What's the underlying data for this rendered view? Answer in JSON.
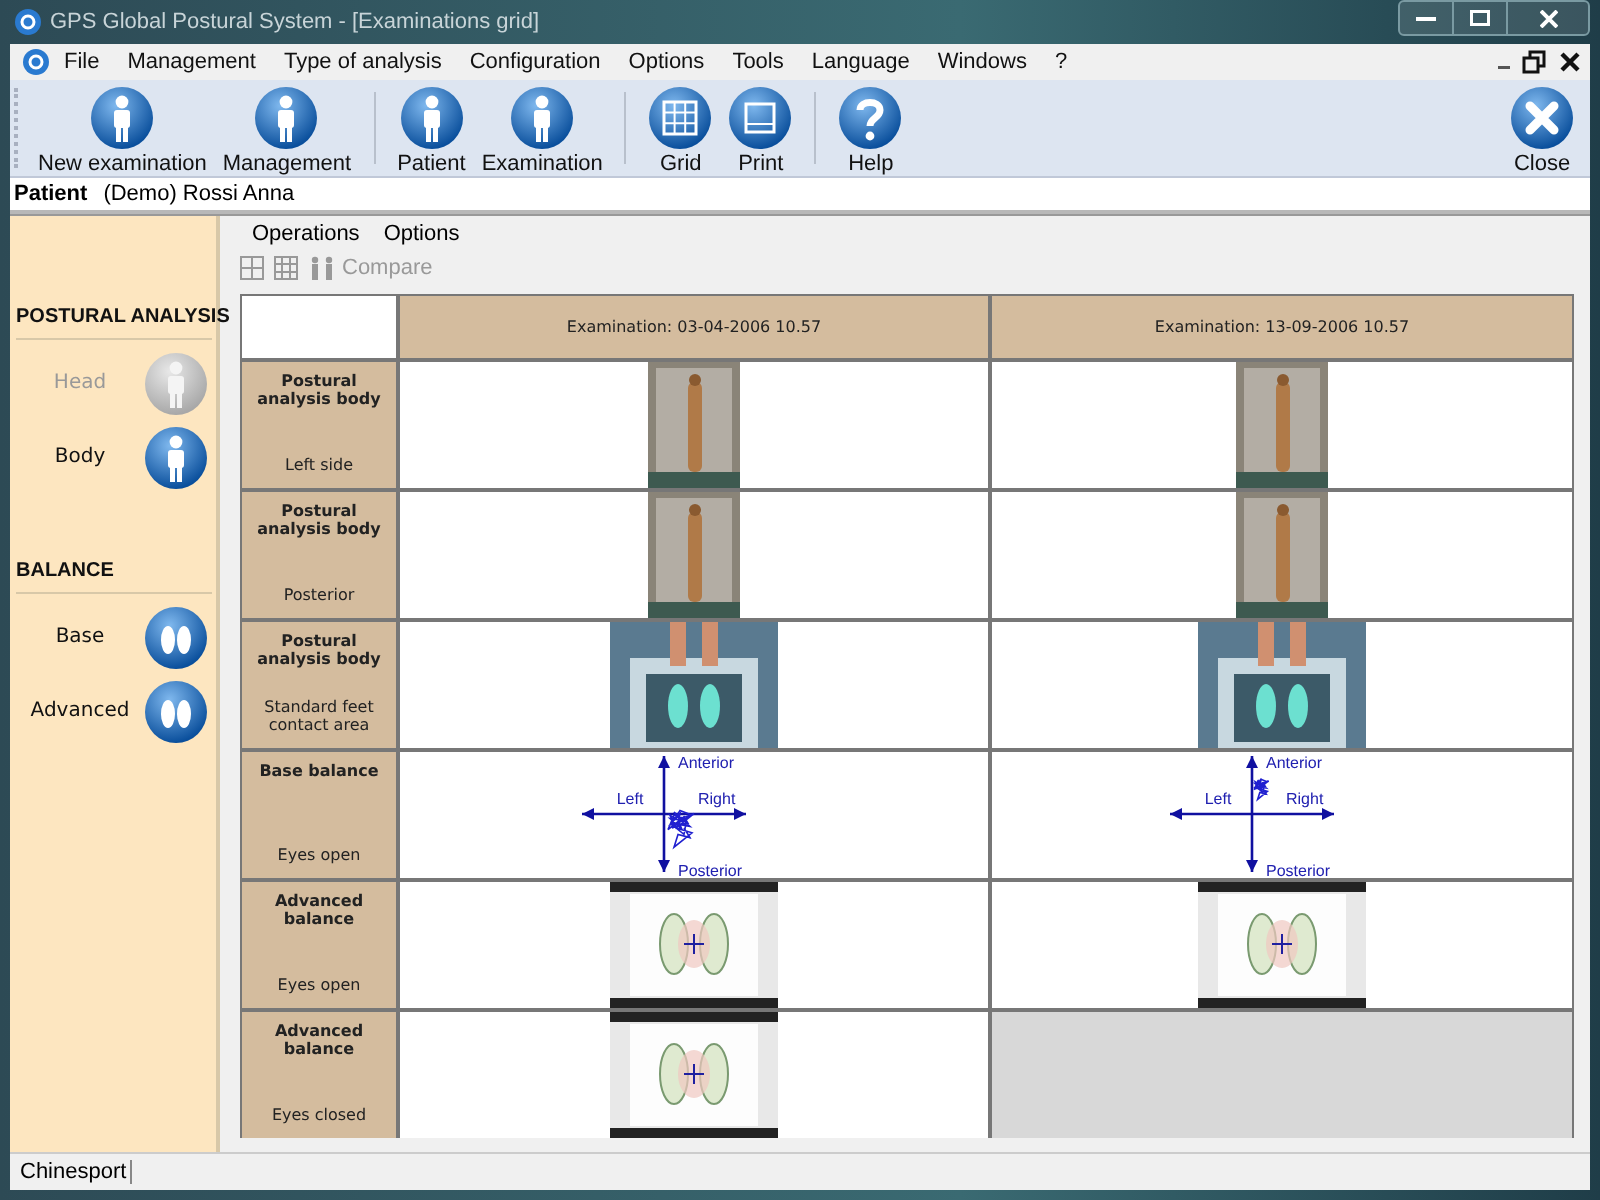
{
  "window": {
    "title": "GPS Global Postural System - [Examinations grid]"
  },
  "menu_bar": {
    "items": [
      "File",
      "Management",
      "Type of analysis",
      "Configuration",
      "Options",
      "Tools",
      "Language",
      "Windows",
      "?"
    ]
  },
  "toolbar": {
    "groups": [
      [
        {
          "label": "New examination"
        },
        {
          "label": "Management"
        }
      ],
      [
        {
          "label": "Patient"
        },
        {
          "label": "Examination"
        }
      ],
      [
        {
          "label": "Grid"
        },
        {
          "label": "Print"
        }
      ],
      [
        {
          "label": "Help"
        }
      ]
    ],
    "close": {
      "label": "Close"
    }
  },
  "patient_bar": {
    "label": "Patient",
    "value": "(Demo) Rossi Anna"
  },
  "sidebar": {
    "sections": [
      {
        "title": "POSTURAL ANALYSIS",
        "items": [
          {
            "label": "Head",
            "disabled": true
          },
          {
            "label": "Body",
            "disabled": false
          }
        ]
      },
      {
        "title": "BALANCE",
        "items": [
          {
            "label": "Base",
            "disabled": false
          },
          {
            "label": "Advanced",
            "disabled": false
          }
        ]
      }
    ]
  },
  "grid_menu": {
    "items": [
      "Operations",
      "Options"
    ]
  },
  "grid_toolbar": {
    "compare": "Compare"
  },
  "table": {
    "columns": [
      "Examination: 03-04-2006 10.57",
      "Examination: 13-09-2006 10.57"
    ],
    "rows": [
      {
        "title": "Postural analysis body",
        "subtitle": "Left side",
        "cells": [
          {
            "kind": "side"
          },
          {
            "kind": "side"
          }
        ]
      },
      {
        "title": "Postural analysis body",
        "subtitle": "Posterior",
        "cells": [
          {
            "kind": "back"
          },
          {
            "kind": "back"
          }
        ]
      },
      {
        "title": "Postural analysis body",
        "subtitle": "Standard feet contact area",
        "cells": [
          {
            "kind": "feet"
          },
          {
            "kind": "feet"
          }
        ]
      },
      {
        "title": "Base balance",
        "subtitle": "Eyes open",
        "cells": [
          {
            "kind": "stabilogram",
            "top": "Anterior",
            "left": "Left",
            "right": "Right",
            "bottom": "Posterior"
          },
          {
            "kind": "stabilogram",
            "top": "Anterior",
            "left": "Left",
            "right": "Right",
            "bottom": "Posterior"
          }
        ]
      },
      {
        "title": "Advanced balance",
        "subtitle": "Eyes open",
        "cells": [
          {
            "kind": "footprint"
          },
          {
            "kind": "footprint"
          }
        ]
      },
      {
        "title": "Advanced balance",
        "subtitle": "Eyes closed",
        "cells": [
          {
            "kind": "footprint"
          },
          {
            "kind": "empty"
          }
        ]
      }
    ]
  },
  "status_bar": {
    "text": "Chinesport"
  }
}
